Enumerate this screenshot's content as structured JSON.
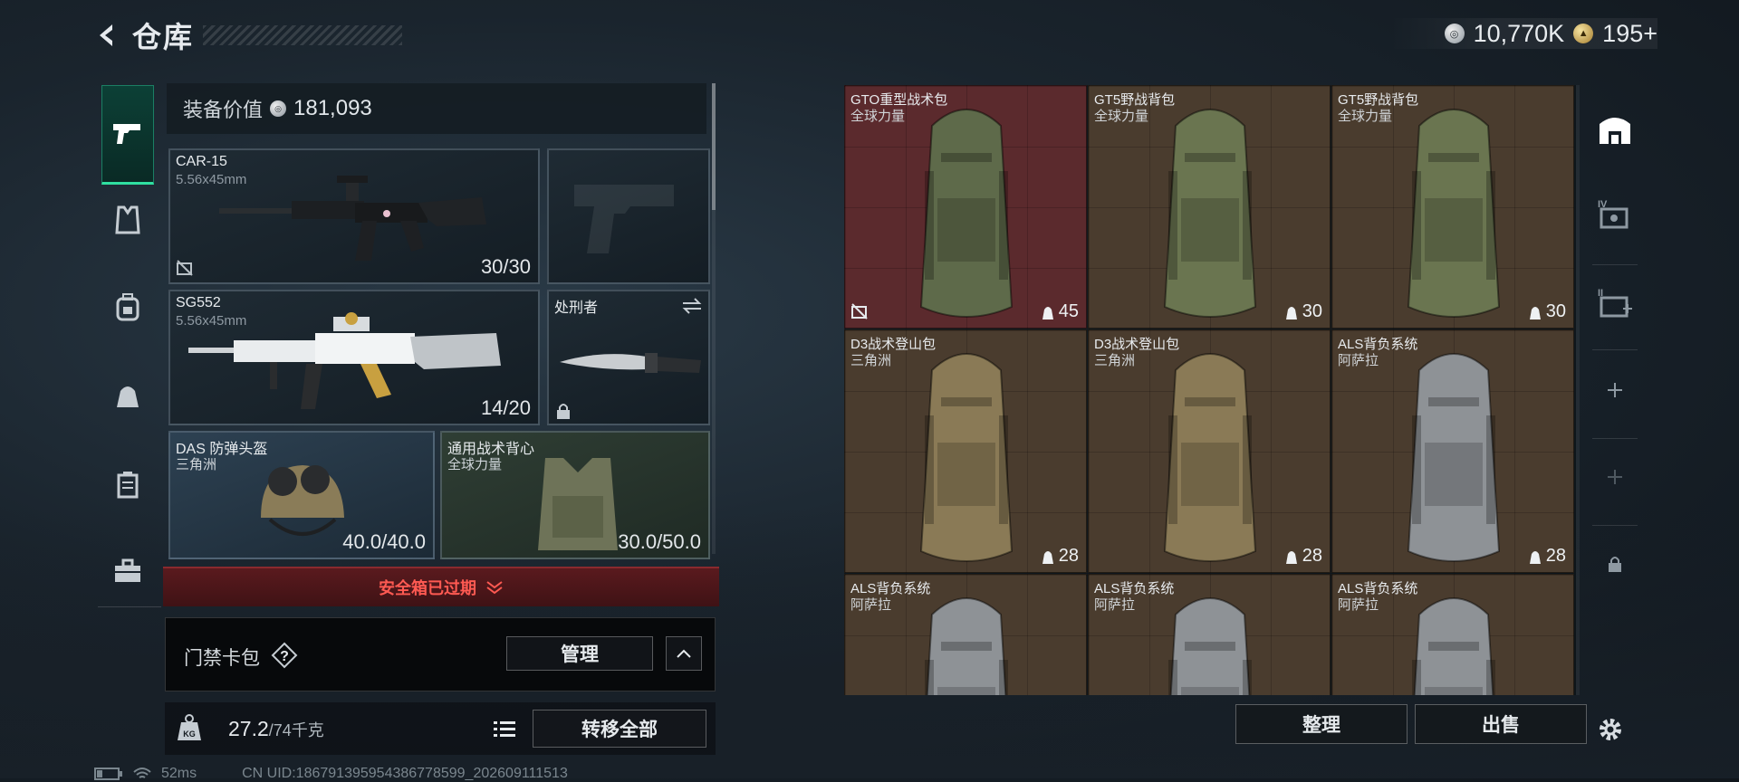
{
  "header": {
    "title": "仓库"
  },
  "currency": {
    "silver": "10,770K",
    "gold": "195+"
  },
  "equipment": {
    "value_label": "装备价值",
    "value": "181,093",
    "primary": {
      "name": "CAR-15",
      "ammo": "5.56x45mm",
      "count": "30/30"
    },
    "secondary": {
      "name": "SG552",
      "ammo": "5.56x45mm",
      "count": "14/20"
    },
    "melee": {
      "name": "处刑者"
    },
    "helmet": {
      "name": "DAS 防弹头盔",
      "faction": "三角洲",
      "durability": "40.0/40.0"
    },
    "armor": {
      "name": "通用战术背心",
      "faction": "全球力量",
      "durability": "30.0/50.0"
    }
  },
  "safe_box": {
    "status": "安全箱已过期"
  },
  "card_bag": {
    "label": "门禁卡包",
    "manage": "管理"
  },
  "weight": {
    "current": "27.2",
    "max": "/74千克",
    "transfer_all": "转移全部"
  },
  "storage": {
    "items": [
      {
        "name": "GTO重型战术包",
        "faction": "全球力量",
        "capacity": "45",
        "highlight": true,
        "color": "#5e6a4a"
      },
      {
        "name": "GT5野战背包",
        "faction": "全球力量",
        "capacity": "30",
        "color": "#6a7550"
      },
      {
        "name": "GT5野战背包",
        "faction": "全球力量",
        "capacity": "30",
        "color": "#6a7550"
      },
      {
        "name": "D3战术登山包",
        "faction": "三角洲",
        "capacity": "28",
        "color": "#8a7a56"
      },
      {
        "name": "D3战术登山包",
        "faction": "三角洲",
        "capacity": "28",
        "color": "#8a7a56"
      },
      {
        "name": "ALS背负系统",
        "faction": "阿萨拉",
        "capacity": "28",
        "color": "#8e9296"
      },
      {
        "name": "ALS背负系统",
        "faction": "阿萨拉",
        "capacity": "",
        "color": "#8e9296"
      },
      {
        "name": "ALS背负系统",
        "faction": "阿萨拉",
        "capacity": "",
        "color": "#8e9296"
      },
      {
        "name": "ALS背负系统",
        "faction": "阿萨拉",
        "capacity": "",
        "color": "#8e9296"
      }
    ],
    "sort": "整理",
    "sell": "出售"
  },
  "status": {
    "ping": "52ms",
    "uid": "CN UID:18679139595438677859​9_202609111513"
  },
  "icons": {
    "back": "back-arrow-icon",
    "gun": "pistol-icon",
    "vest": "vest-icon",
    "backpack": "backpack-icon",
    "bag": "bag-icon",
    "case": "case-icon",
    "briefcase": "briefcase-icon",
    "storage_1": "storage-icon",
    "storage_2": "storage-expand-icon",
    "settings": "gear-icon"
  },
  "colors": {
    "accent": "#2fdfa0",
    "warning": "#ff5a52",
    "highlight_cell": "#5b2a2d"
  }
}
